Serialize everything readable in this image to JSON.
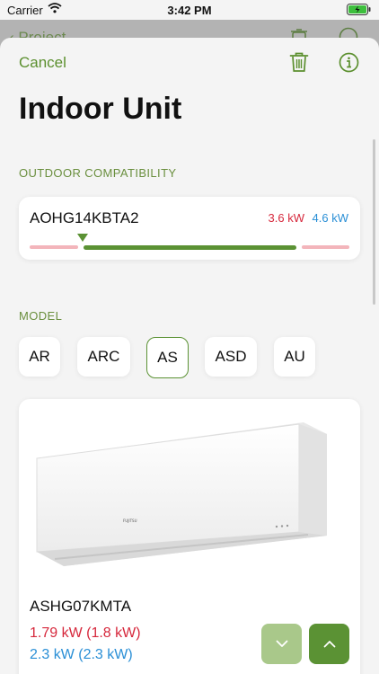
{
  "status_bar": {
    "carrier": "Carrier",
    "time": "3:42 PM"
  },
  "behind_sheet": {
    "back_label": "Project"
  },
  "nav": {
    "cancel_label": "Cancel"
  },
  "title": "Indoor Unit",
  "outdoor_section": {
    "label": "OUTDOOR COMPATIBILITY",
    "model": "AOHG14KBTA2",
    "min_kw": "3.6 kW",
    "max_kw": "4.6 kW"
  },
  "model_section": {
    "label": "MODEL",
    "options": [
      "AR",
      "ARC",
      "AS",
      "ASD",
      "AU"
    ],
    "selected": "AS"
  },
  "product": {
    "name": "ASHG07KMTA",
    "cooling": "1.79 kW (1.8 kW)",
    "heating": "2.3 kW (2.3 kW)",
    "brand": "FUJITSU"
  },
  "colors": {
    "accent": "#5b9234",
    "cool_red": "#d6283c",
    "heat_blue": "#2a8fd6",
    "track_pink": "#f3b5bb"
  },
  "icons": [
    "back-chevron-icon",
    "trash-icon",
    "info-icon",
    "wifi-icon",
    "battery-icon",
    "chevron-down-icon",
    "chevron-up-icon"
  ]
}
